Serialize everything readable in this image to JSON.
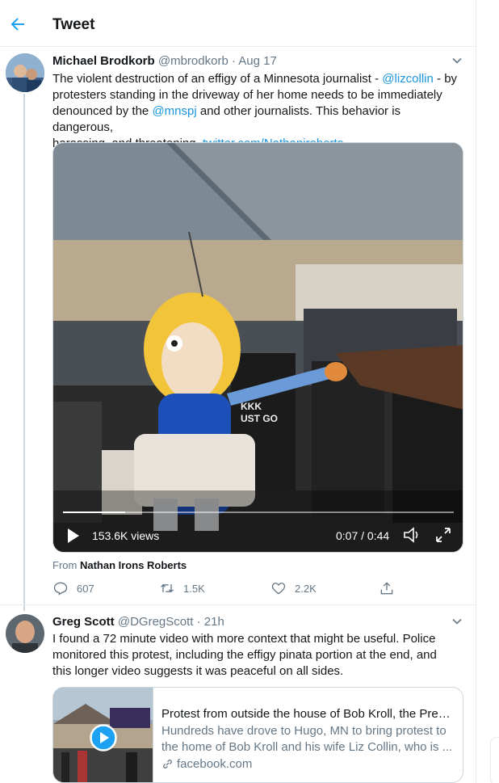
{
  "header": {
    "title": "Tweet"
  },
  "tweet1": {
    "name": "Michael Brodkorb",
    "handle": "@mbrodkorb",
    "date": "· Aug 17",
    "text_lines": [
      [
        "The violent destruction of an effigy of a Minnesota journalist - ",
        "@lizcollin",
        " - by"
      ],
      [
        "protesters standing in the driveway of her home needs to be immediately"
      ],
      [
        "denounced by the ",
        "@mnspj",
        " and other journalists. This behavior is dangerous,"
      ],
      [
        "harassing, and threatening. ",
        "twitter.com/Nathaniroberts..."
      ]
    ],
    "video": {
      "views": "153.6K views",
      "time": "0:07 / 0:44",
      "progress": 0.16,
      "sign_text_1": "KKK",
      "sign_text_2": "UST GO"
    },
    "from_label": "From",
    "from_name": "Nathan Irons Roberts",
    "actions": {
      "replies": "607",
      "retweets": "1.5K",
      "likes": "2.2K"
    }
  },
  "tweet2": {
    "name": "Greg Scott",
    "handle": "@DGregScott",
    "date": "· 21h",
    "text_lines": [
      "I found a 72 minute video with more context that might be useful. Police",
      "monitored this protest, including the effigy pinata portion at the end, and",
      "this longer video suggests it was peaceful on all sides."
    ],
    "card": {
      "title": "Protest from outside the house of Bob Kroll, the Presi...",
      "desc_lines": [
        "Hundreds have drove to Hugo, MN to bring protest to",
        "the home of Bob Kroll and his wife Liz Collin, who is ..."
      ],
      "domain": "facebook.com"
    }
  },
  "colors": {
    "accent": "#1da1f2",
    "link": "#1b95e0",
    "muted": "#657786",
    "border": "#e6ecf0"
  }
}
